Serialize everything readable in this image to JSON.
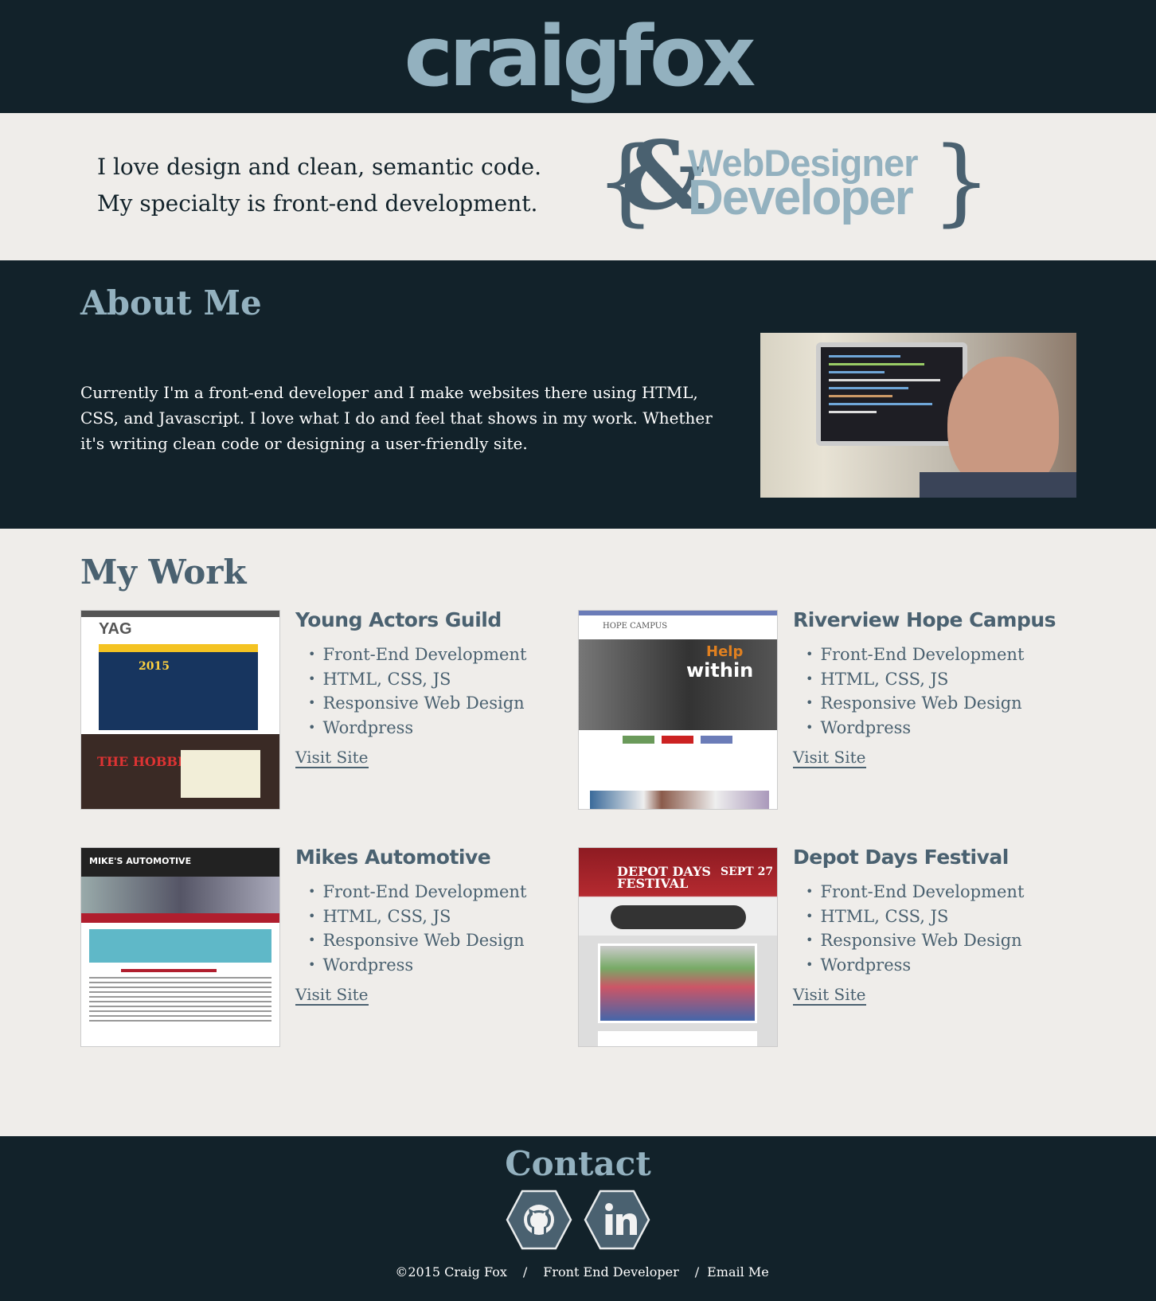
{
  "header": {
    "logo": "craigfox"
  },
  "intro": {
    "text": "I love design and clean, semantic code. My specialty is front-end development.",
    "badge": {
      "amp": "&",
      "line1": "WebDesigner",
      "line2": "Developer"
    }
  },
  "about": {
    "title": "About Me",
    "text": "Currently I'm a front-end developer and I make websites there using HTML, CSS, and Javascript. I love what I do and feel that shows in my work. Whether it's writing clean code or designing a user-friendly site."
  },
  "work": {
    "title": "My Work",
    "items": [
      {
        "title": "Young Actors Guild",
        "skills": [
          "Front-End Development",
          "HTML, CSS, JS",
          "Responsive Web Design",
          "Wordpress"
        ],
        "link": "Visit Site"
      },
      {
        "title": "Riverview Hope Campus",
        "skills": [
          "Front-End Development",
          "HTML, CSS, JS",
          "Responsive Web Design",
          "Wordpress"
        ],
        "link": "Visit Site"
      },
      {
        "title": "Mikes Automotive",
        "skills": [
          "Front-End Development",
          "HTML, CSS, JS",
          "Responsive Web Design",
          "Wordpress"
        ],
        "link": "Visit Site"
      },
      {
        "title": "Depot Days Festival",
        "skills": [
          "Front-End Development",
          "HTML, CSS, JS",
          "Responsive Web Design",
          "Wordpress"
        ],
        "link": "Visit Site"
      }
    ]
  },
  "contact": {
    "title": "Contact",
    "icons": [
      "github-icon",
      "linkedin-icon"
    ],
    "copyright": "©2015 Craig Fox",
    "sep": "/",
    "role": "Front End Developer",
    "email": "Email Me"
  },
  "colors": {
    "dark": "#12222a",
    "light": "#efedea",
    "accent": "#93b1bf",
    "slate": "#4a6170"
  }
}
